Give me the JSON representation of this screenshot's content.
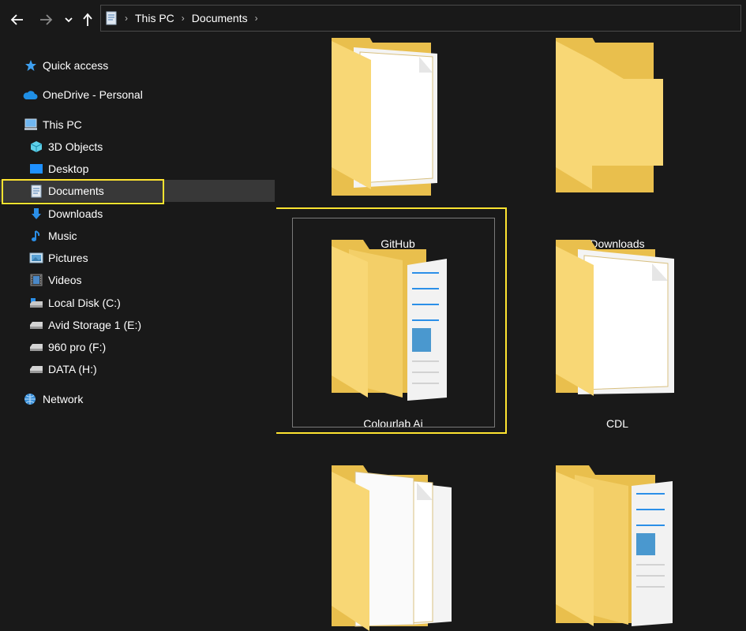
{
  "toolbar": {
    "breadcrumb": [
      "This PC",
      "Documents"
    ],
    "icons": [
      "back-arrow-icon",
      "forward-arrow-icon",
      "recent-chevron-icon",
      "up-arrow-icon",
      "document-folder-icon"
    ]
  },
  "sidebar": {
    "quick_access": "Quick access",
    "onedrive": "OneDrive - Personal",
    "this_pc": "This PC",
    "items": [
      {
        "label": "3D Objects",
        "icon": "3d-objects-icon"
      },
      {
        "label": "Desktop",
        "icon": "desktop-icon"
      },
      {
        "label": "Documents",
        "icon": "documents-icon"
      },
      {
        "label": "Downloads",
        "icon": "downloads-icon"
      },
      {
        "label": "Music",
        "icon": "music-icon"
      },
      {
        "label": "Pictures",
        "icon": "pictures-icon"
      },
      {
        "label": "Videos",
        "icon": "videos-icon"
      },
      {
        "label": "Local Disk (C:)",
        "icon": "local-disk-icon"
      },
      {
        "label": "Avid Storage 1 (E:)",
        "icon": "drive-icon"
      },
      {
        "label": "960 pro (F:)",
        "icon": "drive-icon"
      },
      {
        "label": "DATA (H:)",
        "icon": "drive-icon"
      }
    ],
    "network": "Network",
    "selected": "Documents"
  },
  "content": {
    "folders": [
      {
        "name": "GitHub",
        "icon": "folder-document-icon"
      },
      {
        "name": "Downloads",
        "icon": "folder-empty-icon"
      },
      {
        "name": "Colourlab Ai",
        "icon": "folder-stacked-icon"
      },
      {
        "name": "CDL",
        "icon": "folder-document-icon"
      },
      {
        "name": "",
        "icon": "folder-multi-document-icon"
      },
      {
        "name": "",
        "icon": "folder-stacked-icon"
      }
    ],
    "selected": "Colourlab Ai"
  },
  "colors": {
    "background": "#191919",
    "highlight": "#ffe430",
    "folder": "#f8d775",
    "folder_dark": "#e9bf4d"
  }
}
